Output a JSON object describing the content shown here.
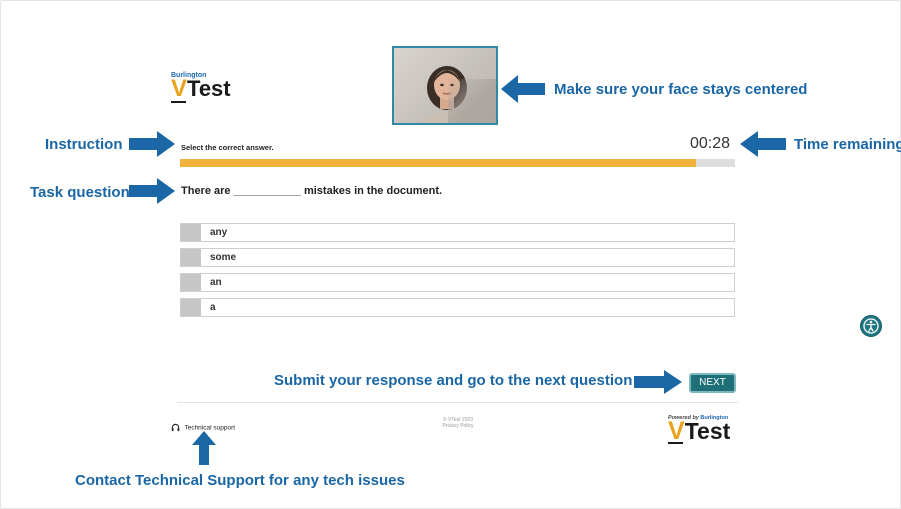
{
  "logo": {
    "brand": "Burlington",
    "v": "V",
    "test": "Test"
  },
  "footer_logo": {
    "powered_by": "Powered by",
    "brand": "Burlington",
    "v": "V",
    "test": "Test"
  },
  "annotations": {
    "face": "Make sure your face stays centered",
    "instruction": "Instruction",
    "time": "Time remaining",
    "task": "Task question",
    "submit": "Submit your response and go to the next question",
    "support": "Contact Technical Support for any tech issues"
  },
  "question": {
    "instruction": "Select the correct answer.",
    "timer": "00:28",
    "progress": 0.93,
    "text_before": "There are",
    "blank": "___________",
    "text_after": "mistakes in the document.",
    "options": [
      "any",
      "some",
      "an",
      "a"
    ]
  },
  "buttons": {
    "next": "NEXT"
  },
  "footer": {
    "tech_support": "Technical support",
    "copyright": "© VTest 2023",
    "privacy": "Privacy Policy"
  },
  "colors": {
    "accent_blue": "#1b66a5",
    "progress": "#f2b33d",
    "next_bg": "#1f6f78"
  },
  "icons": {
    "headset": "headset-icon",
    "accessibility": "accessibility-icon",
    "arrows": "arrow-icon"
  }
}
